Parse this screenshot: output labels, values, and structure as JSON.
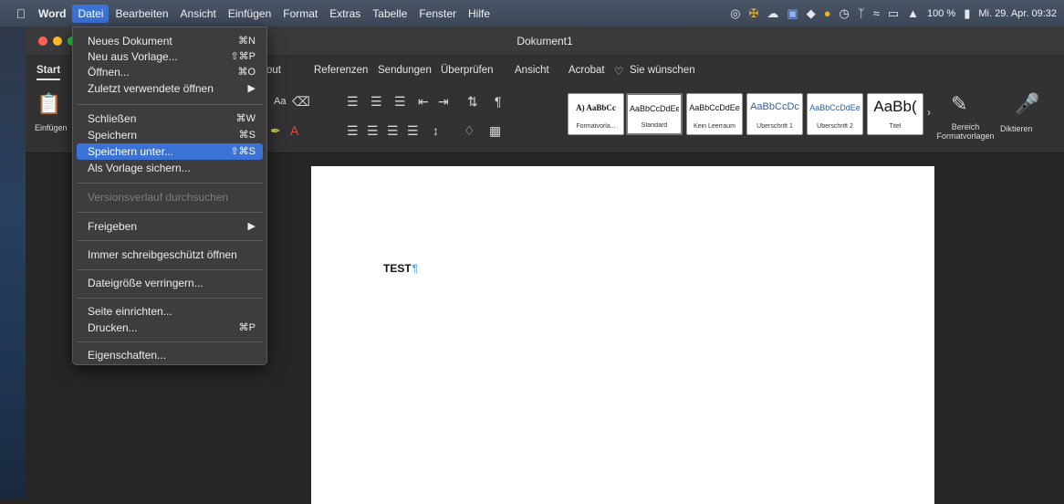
{
  "menubar": {
    "app": "Word",
    "items": [
      "Datei",
      "Bearbeiten",
      "Ansicht",
      "Einfügen",
      "Format",
      "Extras",
      "Tabelle",
      "Fenster",
      "Hilfe"
    ],
    "active": "Datei",
    "battery": "100 %",
    "clock": "Mi. 29. Apr. 09:32"
  },
  "window": {
    "title": "Dokument1"
  },
  "ribbon": {
    "tabs": [
      "Start",
      "out",
      "Referenzen",
      "Sendungen",
      "Überprüfen",
      "Ansicht",
      "Acrobat"
    ],
    "search": "Sie wünschen",
    "paste_label": "Einfügen",
    "case_label": "Aa",
    "styles": [
      {
        "sample": "A) AaBbCc",
        "name": "Formatvorla..."
      },
      {
        "sample": "AaBbCcDdEe",
        "name": "Standard"
      },
      {
        "sample": "AaBbCcDdEe",
        "name": "Kein Leerraum"
      },
      {
        "sample": "AaBbCcDc",
        "name": "Überschrift 1"
      },
      {
        "sample": "AaBbCcDdEe",
        "name": "Überschrift 2"
      },
      {
        "sample": "AaBb(",
        "name": "Titel"
      }
    ],
    "styles_pane_label": "Bereich Formatvorlagen",
    "dictate_label": "Diktieren"
  },
  "document": {
    "text": "TEST",
    "para_mark": "¶"
  },
  "file_menu": {
    "new": {
      "label": "Neues Dokument",
      "shortcut": "⌘N"
    },
    "from_template": {
      "label": "Neu aus Vorlage...",
      "shortcut": "⇧⌘P"
    },
    "open": {
      "label": "Öffnen...",
      "shortcut": "⌘O"
    },
    "recent": {
      "label": "Zuletzt verwendete öffnen",
      "shortcut": "▶"
    },
    "close": {
      "label": "Schließen",
      "shortcut": "⌘W"
    },
    "save": {
      "label": "Speichern",
      "shortcut": "⌘S"
    },
    "save_as": {
      "label": "Speichern unter...",
      "shortcut": "⇧⌘S"
    },
    "save_template": {
      "label": "Als Vorlage sichern..."
    },
    "versions": {
      "label": "Versionsverlauf durchsuchen"
    },
    "share": {
      "label": "Freigeben",
      "shortcut": "▶"
    },
    "readonly": {
      "label": "Immer schreibgeschützt öffnen"
    },
    "reduce": {
      "label": "Dateigröße verringern..."
    },
    "page_setup": {
      "label": "Seite einrichten..."
    },
    "print": {
      "label": "Drucken...",
      "shortcut": "⌘P"
    },
    "properties": {
      "label": "Eigenschaften..."
    }
  },
  "colors": {
    "accent": "#3b72d6"
  }
}
